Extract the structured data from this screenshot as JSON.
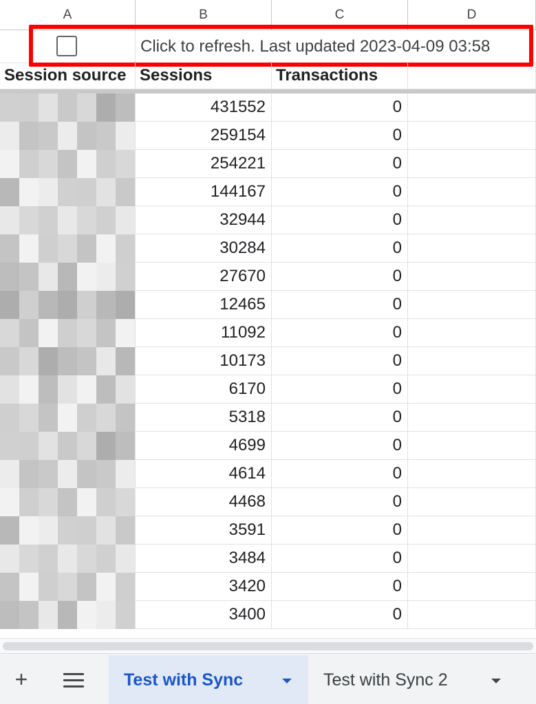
{
  "columns": [
    "A",
    "B",
    "C",
    "D"
  ],
  "refresh": {
    "checked": false,
    "text": "Click to refresh. Last updated 2023-04-09 03:58"
  },
  "headers": {
    "source": "Session source",
    "sessions": "Sessions",
    "transactions": "Transactions"
  },
  "rows": [
    {
      "sessions": "431552",
      "transactions": "0"
    },
    {
      "sessions": "259154",
      "transactions": "0"
    },
    {
      "sessions": "254221",
      "transactions": "0"
    },
    {
      "sessions": "144167",
      "transactions": "0"
    },
    {
      "sessions": "32944",
      "transactions": "0"
    },
    {
      "sessions": "30284",
      "transactions": "0"
    },
    {
      "sessions": "27670",
      "transactions": "0"
    },
    {
      "sessions": "12465",
      "transactions": "0"
    },
    {
      "sessions": "11092",
      "transactions": "0"
    },
    {
      "sessions": "10173",
      "transactions": "0"
    },
    {
      "sessions": "6170",
      "transactions": "0"
    },
    {
      "sessions": "5318",
      "transactions": "0"
    },
    {
      "sessions": "4699",
      "transactions": "0"
    },
    {
      "sessions": "4614",
      "transactions": "0"
    },
    {
      "sessions": "4468",
      "transactions": "0"
    },
    {
      "sessions": "3591",
      "transactions": "0"
    },
    {
      "sessions": "3484",
      "transactions": "0"
    },
    {
      "sessions": "3420",
      "transactions": "0"
    },
    {
      "sessions": "3400",
      "transactions": "0"
    }
  ],
  "tabs": [
    {
      "label": "Test with Sync",
      "active": true
    },
    {
      "label": "Test with Sync 2",
      "active": false
    }
  ],
  "icons": {
    "add": "plus-icon",
    "menu": "menu-icon",
    "dropdown": "caret-down-icon"
  },
  "colors": {
    "highlight": "#ff0000",
    "active_tab_text": "#1a56c9",
    "active_tab_bg": "#e1e9f7"
  }
}
